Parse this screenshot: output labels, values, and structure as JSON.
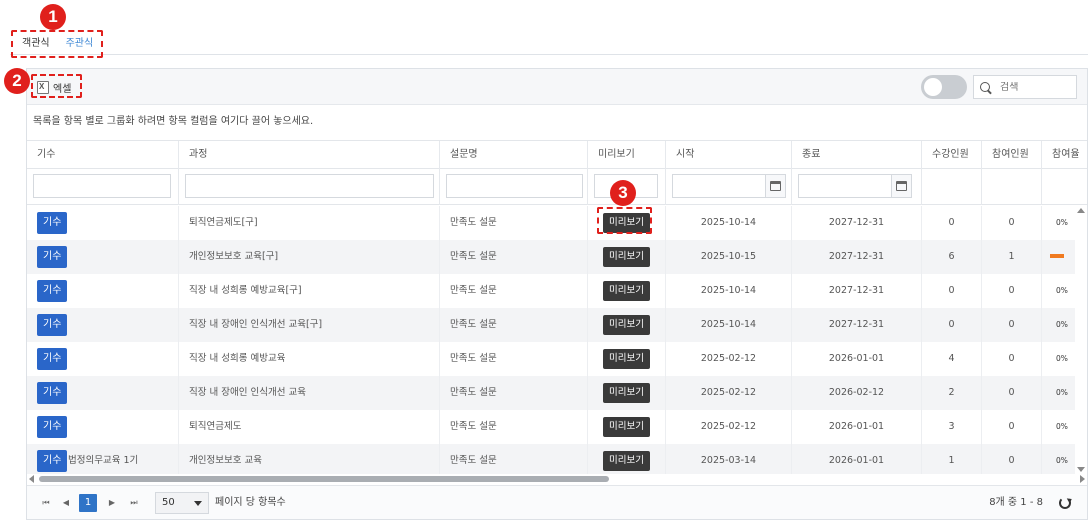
{
  "callouts": [
    "1",
    "2",
    "3"
  ],
  "tabs": [
    {
      "label": "객관식",
      "active": true
    },
    {
      "label": "주관식",
      "active": false
    }
  ],
  "toolbar": {
    "excel_label": "엑셀",
    "search_placeholder": "검색",
    "toggle_on": false
  },
  "group_hint": "목록을 항목 별로 그룹화 하려면 항목 컬럼을 여기다 끌어 놓으세요.",
  "columns": [
    "기수",
    "과정",
    "설문명",
    "미리보기",
    "시작",
    "종료",
    "수강인원",
    "참여인원",
    "참여율"
  ],
  "rows": [
    {
      "batch_btn": "기수",
      "batch": "",
      "course": "퇴직연금제도[구]",
      "survey": "만족도 설문",
      "preview": "미리보기",
      "start": "2025-10-14",
      "end": "2027-12-31",
      "enrolled": "0",
      "participants": "0",
      "rate": "0%",
      "rate_value": 0
    },
    {
      "batch_btn": "기수",
      "batch": "",
      "course": "개인정보보호 교육[구]",
      "survey": "만족도 설문",
      "preview": "미리보기",
      "start": "2025-10-15",
      "end": "2027-12-31",
      "enrolled": "6",
      "participants": "1",
      "rate": "",
      "rate_value": 0.17
    },
    {
      "batch_btn": "기수",
      "batch": "",
      "course": "직장 내 성희롱 예방교육[구]",
      "survey": "만족도 설문",
      "preview": "미리보기",
      "start": "2025-10-14",
      "end": "2027-12-31",
      "enrolled": "0",
      "participants": "0",
      "rate": "0%",
      "rate_value": 0
    },
    {
      "batch_btn": "기수",
      "batch": "",
      "course": "직장 내 장애인 인식개선 교육[구]",
      "survey": "만족도 설문",
      "preview": "미리보기",
      "start": "2025-10-14",
      "end": "2027-12-31",
      "enrolled": "0",
      "participants": "0",
      "rate": "0%",
      "rate_value": 0
    },
    {
      "batch_btn": "기수",
      "batch": "",
      "course": "직장 내 성희롱 예방교육",
      "survey": "만족도 설문",
      "preview": "미리보기",
      "start": "2025-02-12",
      "end": "2026-01-01",
      "enrolled": "4",
      "participants": "0",
      "rate": "0%",
      "rate_value": 0
    },
    {
      "batch_btn": "기수",
      "batch": "",
      "course": "직장 내 장애인 인식개선 교육",
      "survey": "만족도 설문",
      "preview": "미리보기",
      "start": "2025-02-12",
      "end": "2026-02-12",
      "enrolled": "2",
      "participants": "0",
      "rate": "0%",
      "rate_value": 0
    },
    {
      "batch_btn": "기수",
      "batch": "",
      "course": "퇴직연금제도",
      "survey": "만족도 설문",
      "preview": "미리보기",
      "start": "2025-02-12",
      "end": "2026-01-01",
      "enrolled": "3",
      "participants": "0",
      "rate": "0%",
      "rate_value": 0
    },
    {
      "batch_btn": "기수",
      "batch": "법정의무교육 1기",
      "course": "개인정보보호 교육",
      "survey": "만족도 설문",
      "preview": "미리보기",
      "start": "2025-03-14",
      "end": "2026-01-01",
      "enrolled": "1",
      "participants": "0",
      "rate": "0%",
      "rate_value": 0
    }
  ],
  "pager": {
    "first": "⏮",
    "prev": "◀",
    "current": "1",
    "next": "▶",
    "last": "⏭",
    "page_size": "50",
    "page_size_label": "페이지 당 항목수",
    "info": "8개 중 1 - 8"
  },
  "colors": {
    "accent_blue": "#2a66c9",
    "dark_button": "#3a3a3a",
    "callout_red": "#e0201c",
    "progress_orange": "#f07a20"
  }
}
